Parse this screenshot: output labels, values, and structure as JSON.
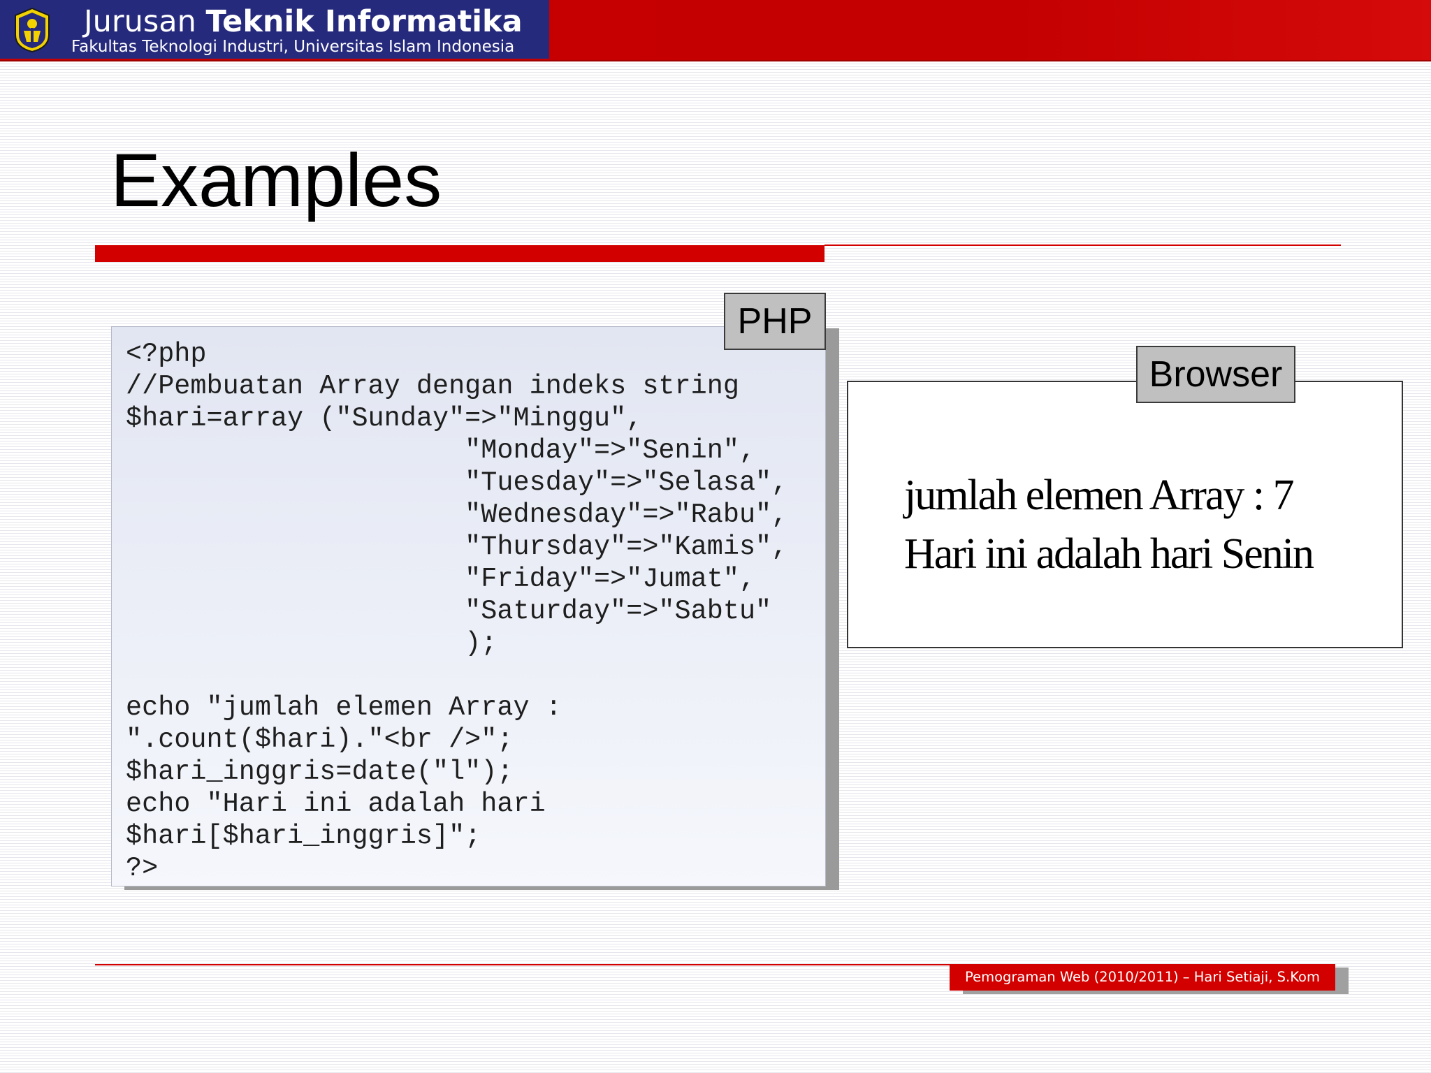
{
  "header": {
    "title_light": "Jurusan",
    "title_bold": "Teknik Informatika",
    "subtitle": "Fakultas Teknologi Industri, Universitas Islam Indonesia",
    "logo_icon": "university-emblem-icon",
    "colors": {
      "brand_navy": "#262a7c",
      "accent_red": "#d30000"
    }
  },
  "slide": {
    "title": "Examples"
  },
  "code_panel": {
    "label": "PHP",
    "code": "<?php\n//Pembuatan Array dengan indeks string\n$hari=array (\"Sunday\"=>\"Minggu\",\n                     \"Monday\"=>\"Senin\",\n                     \"Tuesday\"=>\"Selasa\",\n                     \"Wednesday\"=>\"Rabu\",\n                     \"Thursday\"=>\"Kamis\",\n                     \"Friday\"=>\"Jumat\",\n                     \"Saturday\"=>\"Sabtu\"\n                     );\n\necho \"jumlah elemen Array :\n\".count($hari).\"<br />\";\n$hari_inggris=date(\"l\");\necho \"Hari ini adalah hari\n$hari[$hari_inggris]\";\n?>"
  },
  "browser_panel": {
    "label": "Browser",
    "output_lines": [
      "jumlah elemen Array : 7",
      "Hari ini adalah hari Senin"
    ]
  },
  "footer": {
    "text": "Pemograman Web (2010/2011) – Hari Setiaji, S.Kom"
  }
}
